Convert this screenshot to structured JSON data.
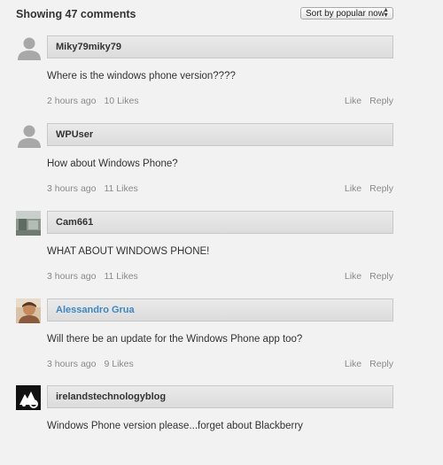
{
  "header": {
    "title": "Showing 47 comments",
    "sort_selected": "Sort by popular now"
  },
  "comments": [
    {
      "author": "Miky79miky79",
      "avatar": "default-person-icon",
      "text": "Where is the windows phone version????",
      "time": "2 hours ago",
      "likes": "10 Likes",
      "like_label": "Like",
      "reply_label": "Reply"
    },
    {
      "author": "WPUser",
      "avatar": "default-person-icon",
      "text": "How about Windows Phone?",
      "time": "3 hours ago",
      "likes": "11 Likes",
      "like_label": "Like",
      "reply_label": "Reply"
    },
    {
      "author": "Cam661",
      "avatar": "photo-avatar",
      "text": "WHAT ABOUT WINDOWS PHONE!",
      "time": "3 hours ago",
      "likes": "11 Likes",
      "like_label": "Like",
      "reply_label": "Reply"
    },
    {
      "author": "Alessandro Grua",
      "avatar": "photo-avatar",
      "text": "Will there be an update for the Windows Phone app too?",
      "time": "3 hours ago",
      "likes": "9 Likes",
      "like_label": "Like",
      "reply_label": "Reply"
    },
    {
      "author": "irelandstechnologyblog",
      "avatar": "logo-avatar",
      "text": "Windows Phone version please...forget about Blackberry"
    }
  ],
  "colors": {
    "background": "#f2f2f2",
    "author_link": "#3b88c3",
    "meta_text": "#8a8a8a"
  }
}
